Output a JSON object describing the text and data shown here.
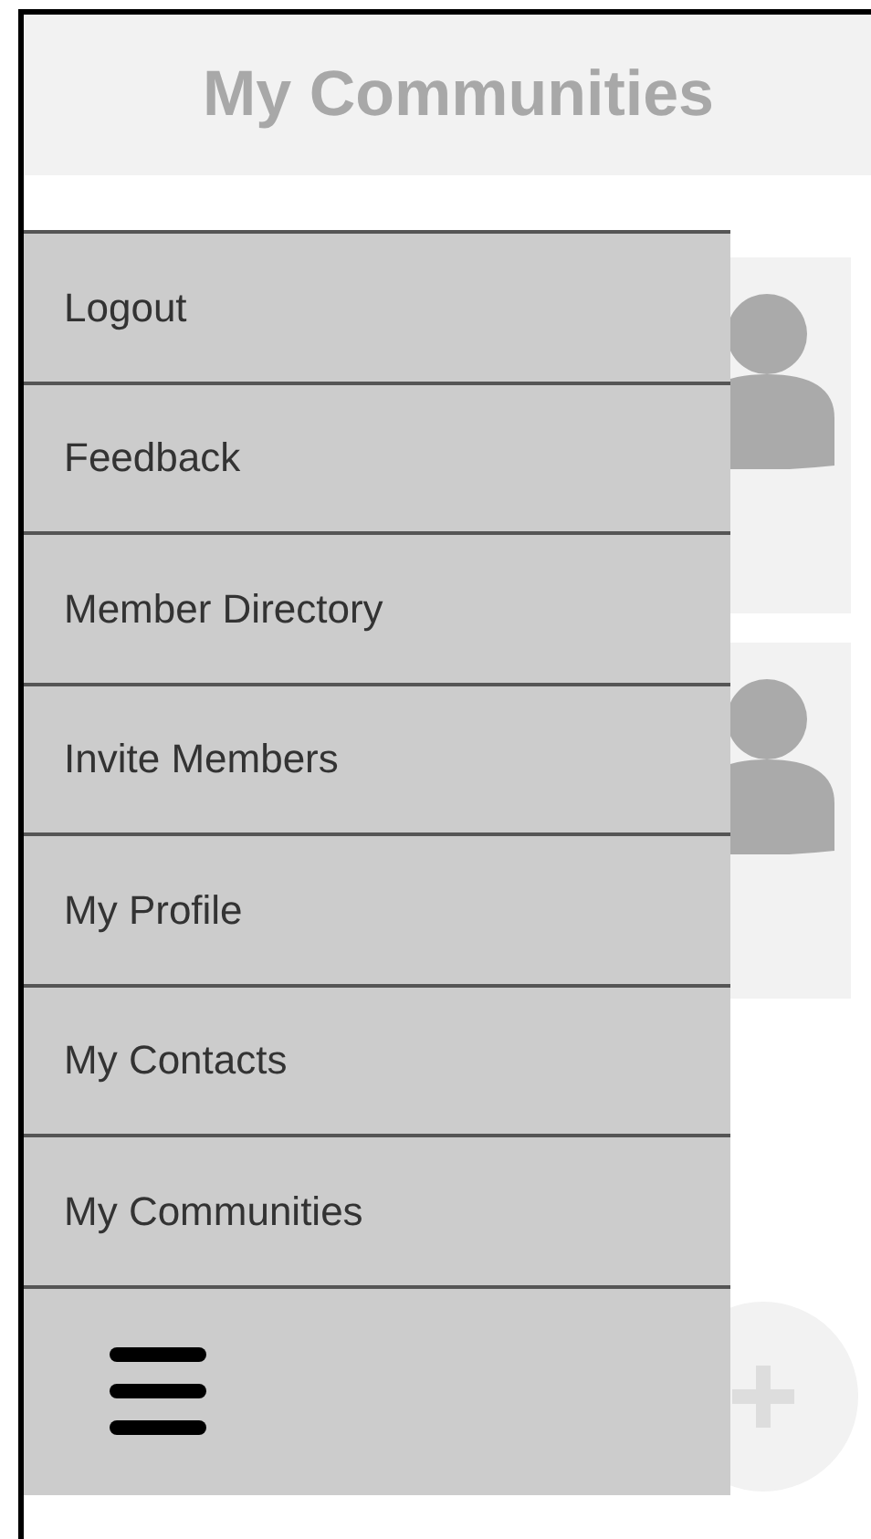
{
  "header": {
    "title": "My Communities"
  },
  "menu": {
    "items": [
      {
        "label": "Logout"
      },
      {
        "label": "Feedback"
      },
      {
        "label": "Member Directory"
      },
      {
        "label": "Invite Members"
      },
      {
        "label": "My Profile"
      },
      {
        "label": "My Contacts"
      },
      {
        "label": "My Communities"
      }
    ]
  }
}
